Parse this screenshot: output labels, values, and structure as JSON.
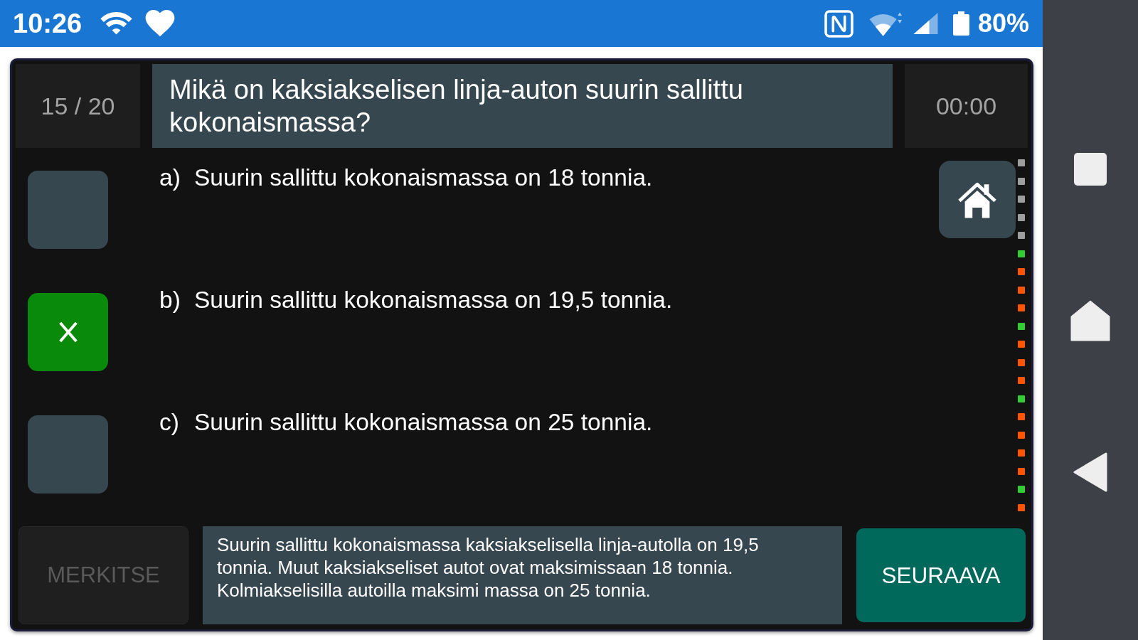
{
  "status_bar": {
    "time": "10:26",
    "battery": "80%"
  },
  "quiz": {
    "counter": "15 / 20",
    "question": "Mikä on kaksiakselisen linja-auton suurin sallittu kokonaismassa?",
    "timer": "00:00",
    "answers": [
      {
        "letter": "a)",
        "text": "Suurin sallittu kokonaismassa on 18 tonnia.",
        "selected": false
      },
      {
        "letter": "b)",
        "text": "Suurin sallittu kokonaismassa on 19,5 tonnia.",
        "selected": true
      },
      {
        "letter": "c)",
        "text": "Suurin sallittu kokonaismassa on 25 tonnia.",
        "selected": false
      }
    ],
    "progress": [
      {
        "color": "#9e9e9e"
      },
      {
        "color": "#9e9e9e"
      },
      {
        "color": "#9e9e9e"
      },
      {
        "color": "#9e9e9e"
      },
      {
        "color": "#9e9e9e"
      },
      {
        "color": "#33cc33"
      },
      {
        "color": "#ff5500"
      },
      {
        "color": "#ff5500"
      },
      {
        "color": "#ff5500"
      },
      {
        "color": "#33cc33"
      },
      {
        "color": "#ff5500"
      },
      {
        "color": "#ff5500"
      },
      {
        "color": "#ff5500"
      },
      {
        "color": "#33cc33"
      },
      {
        "color": "#ff5500"
      },
      {
        "color": "#ff5500"
      },
      {
        "color": "#ff5500"
      },
      {
        "color": "#ff5500"
      },
      {
        "color": "#33cc33"
      },
      {
        "color": "#ff5500"
      }
    ],
    "mark_button": {
      "label": "MERKITSE",
      "disabled": true
    },
    "explanation": "Suurin sallittu kokonaismassa kaksiakselisella linja-autolla on 19,5 tonnia. Muut kaksiakseliset autot ovat maksimissaan 18 tonnia. Kolmiakselisilla autoilla maksimi massa on 25 tonnia.",
    "next_button": {
      "label": "SEURAAVA"
    }
  }
}
